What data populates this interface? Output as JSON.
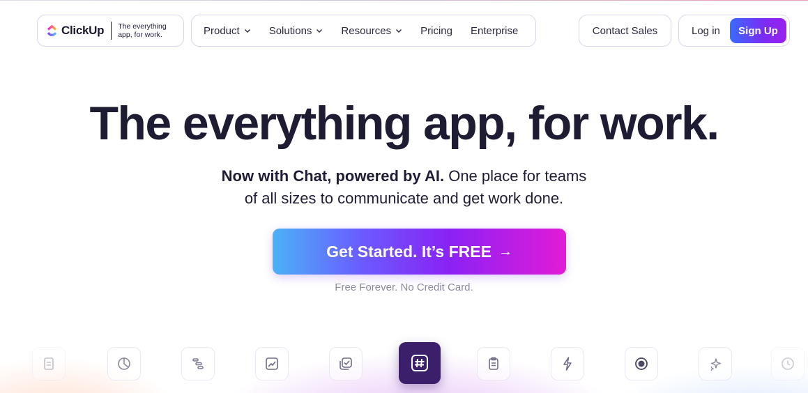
{
  "header": {
    "logo": {
      "name": "ClickUp",
      "tagline": "The everything app, for work."
    },
    "nav": [
      {
        "label": "Product",
        "dropdown": true
      },
      {
        "label": "Solutions",
        "dropdown": true
      },
      {
        "label": "Resources",
        "dropdown": true
      },
      {
        "label": "Pricing",
        "dropdown": false
      },
      {
        "label": "Enterprise",
        "dropdown": false
      }
    ],
    "contact_sales": "Contact Sales",
    "login": "Log in",
    "signup": "Sign Up"
  },
  "hero": {
    "title": "The everything app, for work.",
    "subtitle_bold": "Now with Chat, powered by AI.",
    "subtitle_rest_1": " One place for teams",
    "subtitle_rest_2": "of all sizes to communicate and get work done.",
    "cta_label": "Get Started. It’s FREE",
    "cta_arrow": "→",
    "cta_note": "Free Forever. No Credit Card."
  },
  "features": [
    {
      "icon": "doc-icon",
      "active": false
    },
    {
      "icon": "pie-chart-icon",
      "active": false
    },
    {
      "icon": "gantt-icon",
      "active": false
    },
    {
      "icon": "line-chart-icon",
      "active": false
    },
    {
      "icon": "tasks-check-icon",
      "active": false
    },
    {
      "icon": "hashtag-chat-icon",
      "active": true
    },
    {
      "icon": "clipboard-icon",
      "active": false
    },
    {
      "icon": "lightning-icon",
      "active": false
    },
    {
      "icon": "record-icon",
      "active": false
    },
    {
      "icon": "sparkle-ai-icon",
      "active": false
    },
    {
      "icon": "clock-icon",
      "active": false
    }
  ],
  "colors": {
    "brand_purple": "#7b2cf3",
    "brand_blue": "#3a6bff",
    "cta_pink": "#e21bd6",
    "text_dark": "#1e1c33",
    "active_icon_bg": "#3b1f6b"
  }
}
